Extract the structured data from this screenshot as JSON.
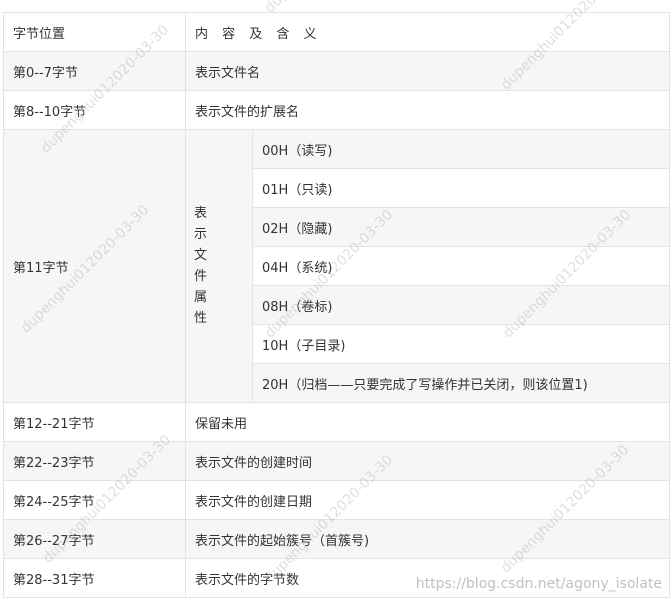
{
  "header": {
    "col1": "字节位置",
    "col2": "内 容 及 含 义"
  },
  "rows": [
    {
      "pos": "第0--7字节",
      "meaning": "表示文件名"
    },
    {
      "pos": "第8--10字节",
      "meaning": "表示文件的扩展名"
    }
  ],
  "attr": {
    "pos": "第11字节",
    "desc": "表示文件属性",
    "values": [
      "00H（读写)",
      "01H（只读)",
      "02H（隐藏)",
      "04H（系统)",
      "08H（卷标)",
      "10H（子目录)",
      "20H（归档——只要完成了写操作并已关闭，则该位置1)"
    ]
  },
  "rows_after": [
    {
      "pos": "第12--21字节",
      "meaning": "保留未用"
    },
    {
      "pos": "第22--23字节",
      "meaning": "表示文件的创建时间"
    },
    {
      "pos": "第24--25字节",
      "meaning": "表示文件的创建日期"
    },
    {
      "pos": "第26--27字节",
      "meaning": "表示文件的起始簇号（首簇号)"
    },
    {
      "pos": "第28--31字节",
      "meaning": "表示文件的字节数"
    }
  ],
  "watermark": "dupenghui012020-03-30",
  "csdn_watermark": "https://blog.csdn.net/agony_isolate"
}
